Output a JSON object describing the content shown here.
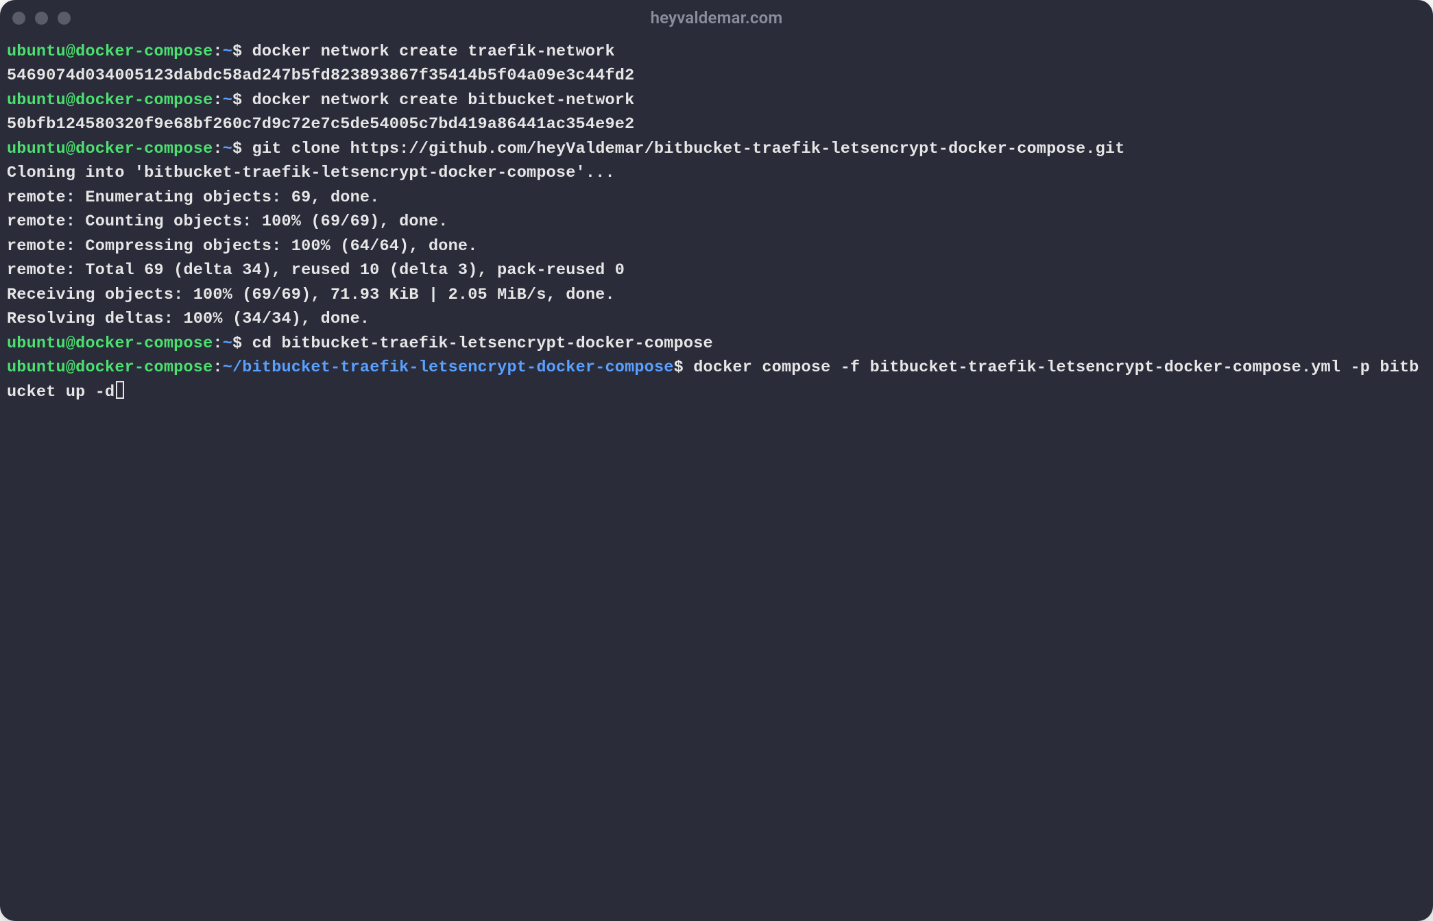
{
  "window": {
    "title": "heyvaldemar.com"
  },
  "prompt": {
    "user": "ubuntu",
    "at": "@",
    "host": "docker-compose",
    "colon": ":",
    "home_path": "~",
    "deep_path": "~/bitbucket-traefik-letsencrypt-docker-compose",
    "symbol": "$"
  },
  "lines": {
    "cmd1": " docker network create traefik-network",
    "out1": "5469074d034005123dabdc58ad247b5fd823893867f35414b5f04a09e3c44fd2",
    "cmd2": " docker network create bitbucket-network",
    "out2": "50bfb124580320f9e68bf260c7d9c72e7c5de54005c7bd419a86441ac354e9e2",
    "cmd3": " git clone https://github.com/heyValdemar/bitbucket-traefik-letsencrypt-docker-compose.git",
    "out3a": "Cloning into 'bitbucket-traefik-letsencrypt-docker-compose'...",
    "out3b": "remote: Enumerating objects: 69, done.",
    "out3c": "remote: Counting objects: 100% (69/69), done.",
    "out3d": "remote: Compressing objects: 100% (64/64), done.",
    "out3e": "remote: Total 69 (delta 34), reused 10 (delta 3), pack-reused 0",
    "out3f": "Receiving objects: 100% (69/69), 71.93 KiB | 2.05 MiB/s, done.",
    "out3g": "Resolving deltas: 100% (34/34), done.",
    "cmd4": " cd bitbucket-traefik-letsencrypt-docker-compose",
    "cmd5": " docker compose -f bitbucket-traefik-letsencrypt-docker-compose.yml -p bitbucket up -d"
  }
}
